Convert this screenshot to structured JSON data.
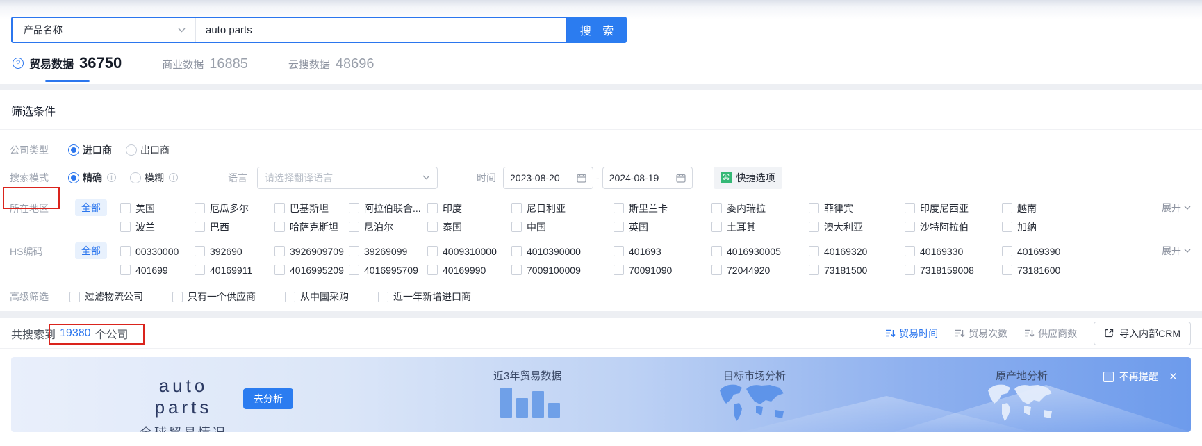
{
  "search": {
    "field_label": "产品名称",
    "query": "auto parts",
    "button": "搜 索"
  },
  "tabs": [
    {
      "label": "贸易数据",
      "count": "36750"
    },
    {
      "label": "商业数据",
      "count": "16885"
    },
    {
      "label": "云搜数据",
      "count": "48696"
    }
  ],
  "filters": {
    "title": "筛选条件",
    "company_type": {
      "label": "公司类型",
      "options": [
        {
          "label": "进口商",
          "selected": true
        },
        {
          "label": "出口商",
          "selected": false
        }
      ]
    },
    "search_mode": {
      "label": "搜索模式",
      "options": [
        {
          "label": "精确",
          "selected": true
        },
        {
          "label": "模糊",
          "selected": false
        }
      ]
    },
    "language": {
      "label": "语言",
      "placeholder": "请选择翻译语言"
    },
    "time": {
      "label": "时间",
      "start": "2023-08-20",
      "end": "2024-08-19",
      "separator": "-"
    },
    "quick_option": "快捷选项",
    "region": {
      "label": "所在地区",
      "all_label": "全部",
      "expand_label": "展开",
      "row1": [
        "美国",
        "厄瓜多尔",
        "巴基斯坦",
        "阿拉伯联合...",
        "印度",
        "尼日利亚",
        "斯里兰卡",
        "委内瑞拉",
        "菲律宾",
        "印度尼西亚",
        "越南"
      ],
      "row2": [
        "波兰",
        "巴西",
        "哈萨克斯坦",
        "尼泊尔",
        "泰国",
        "中国",
        "英国",
        "土耳其",
        "澳大利亚",
        "沙特阿拉伯",
        "加纳"
      ]
    },
    "hs_code": {
      "label": "HS编码",
      "all_label": "全部",
      "expand_label": "展开",
      "row1": [
        "00330000",
        "392690",
        "3926909709",
        "39269099",
        "4009310000",
        "4010390000",
        "401693",
        "4016930005",
        "40169320",
        "40169330",
        "40169390"
      ],
      "row2": [
        "401699",
        "40169911",
        "4016995209",
        "4016995709",
        "40169990",
        "7009100009",
        "70091090",
        "72044920",
        "73181500",
        "7318159008",
        "73181600"
      ]
    },
    "advanced": {
      "label": "高级筛选",
      "options": [
        "过滤物流公司",
        "只有一个供应商",
        "从中国采购",
        "近一年新增进口商"
      ]
    }
  },
  "results": {
    "summary_prefix": "共搜索到",
    "summary_count": "19380",
    "summary_suffix": "个公司",
    "sorts": [
      "贸易时间",
      "贸易次数",
      "供应商数"
    ],
    "active_sort": "贸易时间",
    "crm_button": "导入内部CRM"
  },
  "banner": {
    "title": "auto parts",
    "subtitle": "全球贸易情况",
    "analyze_button": "去分析",
    "label_trade": "近3年贸易数据",
    "label_market": "目标市场分析",
    "label_origin": "原产地分析",
    "dismiss_label": "不再提醒",
    "close_glyph": "×",
    "bar_styles": [
      "height:43px",
      "height:28px",
      "height:38px",
      "height:21px"
    ]
  },
  "icons": {
    "command_glyph": "⌘",
    "question_glyph": "?",
    "info_glyph": "i"
  },
  "colors": {
    "primary": "#2b76ee",
    "annotation": "#da241d",
    "quick_green": "#35b876"
  }
}
